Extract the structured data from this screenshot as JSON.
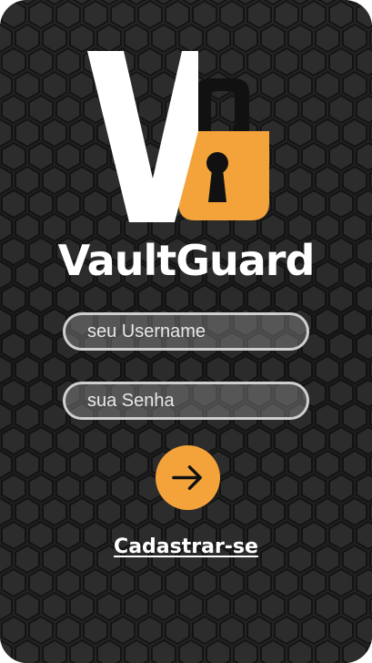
{
  "brand": {
    "name": "VaultGuard",
    "accent_color": "#f4a33a",
    "logo_icon": "v-padlock-logo-icon"
  },
  "login": {
    "username_placeholder": "seu Username",
    "password_placeholder": "sua Senha",
    "submit_icon": "arrow-right-icon",
    "signup_label": "Cadastrar-se"
  },
  "theme": {
    "background": "#1d1d1d",
    "text": "#ffffff",
    "field_border": "#cfcfcf"
  }
}
